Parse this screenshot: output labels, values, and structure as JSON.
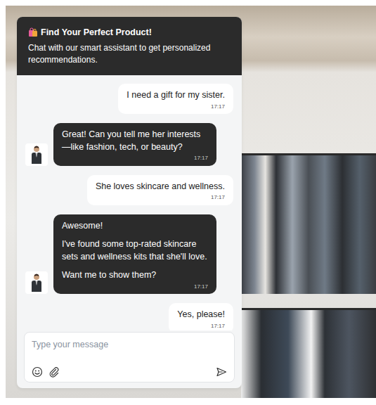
{
  "header": {
    "title": "Find Your Perfect Product!",
    "subtitle": "Chat with our smart assistant to get personalized recommendations."
  },
  "messages": [
    {
      "kind": "user",
      "paragraphs": [
        "I need a gift for my sister."
      ],
      "time": "17:17"
    },
    {
      "kind": "bot",
      "paragraphs": [
        "Great! Can you tell me her interests—like fashion, tech, or beauty?"
      ],
      "time": "17:17"
    },
    {
      "kind": "user",
      "paragraphs": [
        "She loves skincare and wellness."
      ],
      "time": "17:17"
    },
    {
      "kind": "bot",
      "paragraphs": [
        "Awesome!",
        "I've found some top-rated skincare sets and wellness kits that she'll love.",
        "Want me to show them?"
      ],
      "time": "17:17"
    },
    {
      "kind": "user",
      "paragraphs": [
        "Yes, please!"
      ],
      "time": "17:17"
    }
  ],
  "composer": {
    "placeholder": "Type your message"
  }
}
